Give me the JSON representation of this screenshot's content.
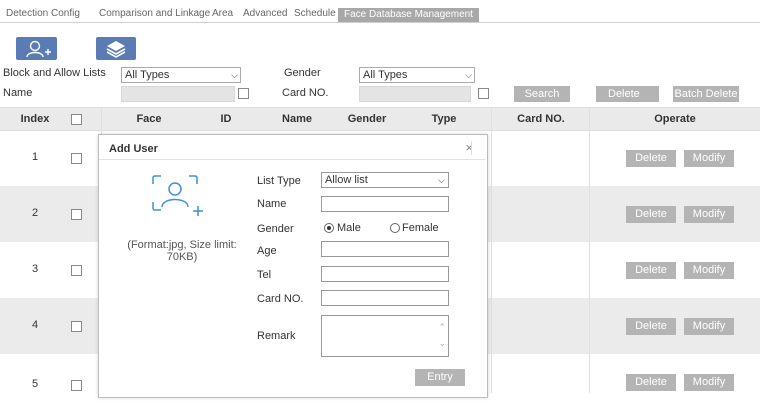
{
  "tabs": [
    "Detection Config",
    "Comparison and Linkage",
    "Area",
    "Advanced",
    "Schedule",
    "Face Database Management"
  ],
  "toolbar": {
    "add_user_icon": "add-user-icon",
    "layers_icon": "layers-icon"
  },
  "filters": {
    "list_label": "Block and Allow Lists",
    "list_value": "All Types",
    "gender_label": "Gender",
    "gender_value": "All Types",
    "name_label": "Name",
    "card_label": "Card NO.",
    "search": "Search",
    "delete": "Delete",
    "batch_delete": "Batch Delete"
  },
  "table": {
    "headers": [
      "Index",
      "Face",
      "ID",
      "Name",
      "Gender",
      "Type",
      "Card NO.",
      "Operate"
    ],
    "rows": [
      {
        "index": "1"
      },
      {
        "index": "2"
      },
      {
        "index": "3"
      },
      {
        "index": "4"
      },
      {
        "index": "5"
      }
    ],
    "delete": "Delete",
    "modify": "Modify"
  },
  "dialog": {
    "title": "Add User",
    "close": "×",
    "format_note": "(Format:jpg, Size limit: 70KB)",
    "list_type_label": "List Type",
    "list_type_value": "Allow list",
    "name_label": "Name",
    "gender_label": "Gender",
    "male": "Male",
    "female": "Female",
    "gender_selected": "Male",
    "age_label": "Age",
    "tel_label": "Tel",
    "card_label": "Card NO.",
    "remark_label": "Remark",
    "entry": "Entry"
  },
  "colors": {
    "accent": "#5a7bb3",
    "button_grey": "#b4b4b4",
    "row_alt": "#ebebeb",
    "icon_blue": "#3f8fd6"
  }
}
